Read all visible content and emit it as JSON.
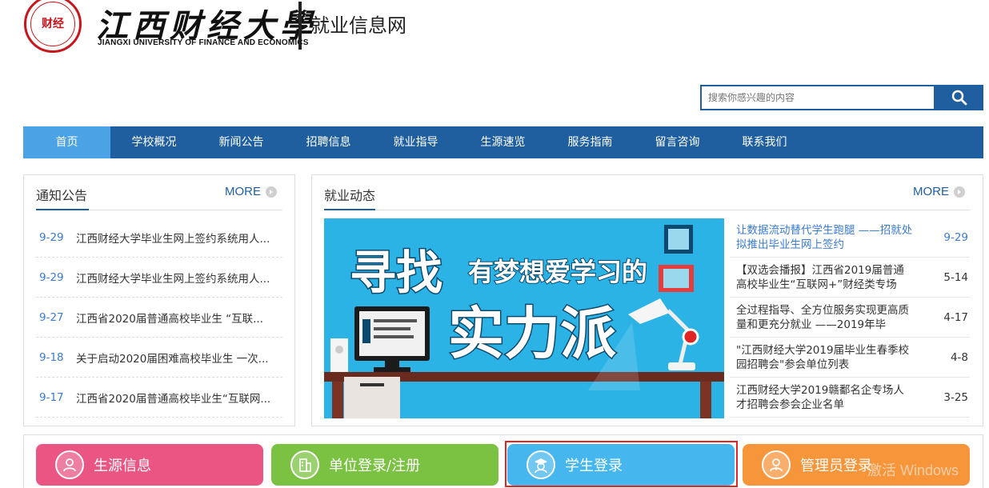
{
  "header": {
    "seal_text": "财经",
    "school_name_cn": "江西财经大學",
    "school_name_en": "JIANGXI UNIVERSITY OF FINANCE AND ECONOMICS",
    "site_name": "就业信息网"
  },
  "search": {
    "placeholder": "搜索你感兴趣的内容",
    "icon": "search-icon"
  },
  "nav": {
    "items": [
      "首页",
      "学校概况",
      "新闻公告",
      "招聘信息",
      "就业指导",
      "生源速览",
      "服务指南",
      "留言咨询",
      "联系我们"
    ],
    "active_index": 0
  },
  "notice": {
    "title": "通知公告",
    "more": "MORE",
    "items": [
      {
        "date": "9-29",
        "title": "江西财经大学毕业生网上签约系统用人..."
      },
      {
        "date": "9-29",
        "title": "江西财经大学毕业生网上签约系统用人..."
      },
      {
        "date": "9-27",
        "title": "江西省2020届普通高校毕业生 “互联..."
      },
      {
        "date": "9-18",
        "title": "关于启动2020届困难高校毕业生 一次..."
      },
      {
        "date": "9-17",
        "title": "江西省2020届普通高校毕业生“互联网..."
      }
    ]
  },
  "news": {
    "title": "就业动态",
    "more": "MORE",
    "banner": {
      "line1": "寻找",
      "line2": "有梦想爱学习的",
      "line3": "实力派"
    },
    "items": [
      {
        "title": "让数据流动替代学生跑腿 ——招就处拟推出毕业生网上签约",
        "date": "9-29",
        "highlight": true
      },
      {
        "title": "【双选会播报】江西省2019届普通高校毕业生“互联网+”财经类专场",
        "date": "5-14",
        "highlight": false
      },
      {
        "title": "全过程指导、全方位服务实现更高质量和更充分就业 ——2019年毕",
        "date": "4-17",
        "highlight": false
      },
      {
        "title": "\"江西财经大学2019届毕业生春季校园招聘会\"参会单位列表",
        "date": "4-8",
        "highlight": false
      },
      {
        "title": "江西财经大学2019赣鄱名企专场人才招聘会参会企业名单",
        "date": "3-25",
        "highlight": false
      }
    ]
  },
  "quick_links": [
    {
      "label": "生源信息",
      "icon": "user-group-icon",
      "color": "#ea5583"
    },
    {
      "label": "单位登录/注册",
      "icon": "building-icon",
      "color": "#7bc243"
    },
    {
      "label": "学生登录",
      "icon": "graduate-icon",
      "color": "#45b6ee"
    },
    {
      "label": "管理员登录",
      "icon": "admin-icon",
      "color": "#f7953a"
    }
  ],
  "overlay": {
    "watermark": "激活 Windows"
  },
  "colors": {
    "primary": "#1f5fa0",
    "nav_active": "#4ba3e6",
    "link_blue": "#3a7bd5",
    "banner_bg": "#2bb3e6",
    "highlight_border": "#e02525"
  }
}
